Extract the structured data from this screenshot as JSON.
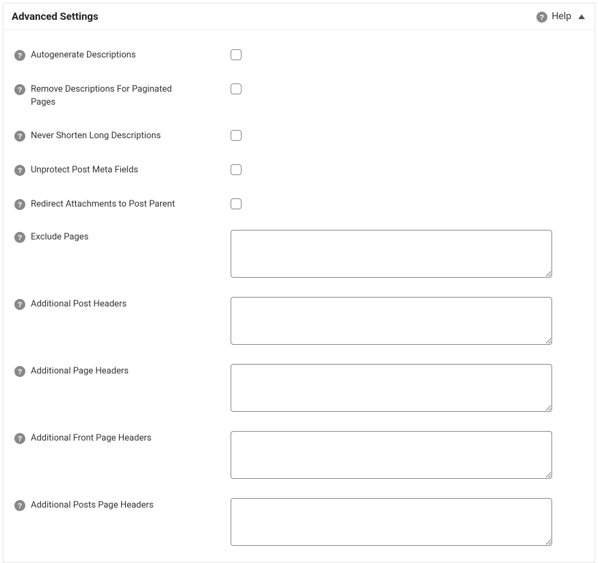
{
  "header": {
    "title": "Advanced Settings",
    "help_label": "Help"
  },
  "fields": {
    "autogen_desc": {
      "label": "Autogenerate Descriptions"
    },
    "remove_paginated": {
      "label": "Remove Descriptions For Paginated Pages"
    },
    "never_shorten": {
      "label": "Never Shorten Long Descriptions"
    },
    "unprotect_meta": {
      "label": "Unprotect Post Meta Fields"
    },
    "redirect_attach": {
      "label": "Redirect Attachments to Post Parent"
    },
    "exclude_pages": {
      "label": "Exclude Pages",
      "value": ""
    },
    "add_post_headers": {
      "label": "Additional Post Headers",
      "value": ""
    },
    "add_page_headers": {
      "label": "Additional Page Headers",
      "value": ""
    },
    "add_front_headers": {
      "label": "Additional Front Page Headers",
      "value": ""
    },
    "add_posts_page_headers": {
      "label": "Additional Posts Page Headers",
      "value": ""
    }
  }
}
